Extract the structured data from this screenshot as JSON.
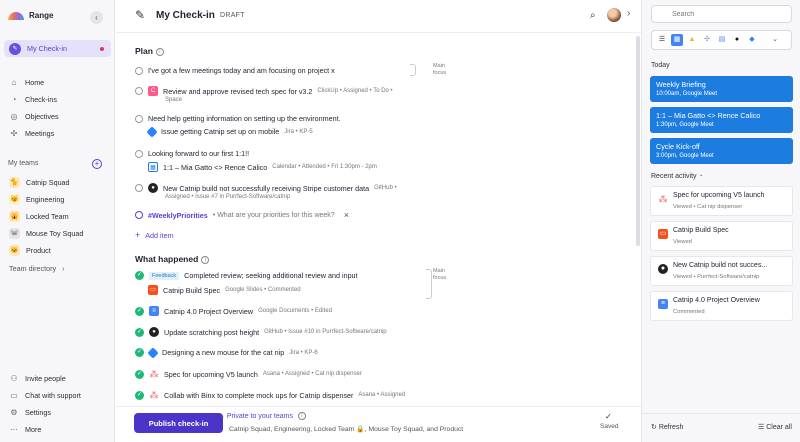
{
  "app": {
    "name": "Range"
  },
  "sidebar": {
    "primary": {
      "label": "My Check-in"
    },
    "nav": [
      {
        "label": "Home",
        "icon": "home-icon"
      },
      {
        "label": "Check-ins",
        "icon": "checkins-icon"
      },
      {
        "label": "Objectives",
        "icon": "target-icon"
      },
      {
        "label": "Meetings",
        "icon": "meetings-icon"
      }
    ],
    "teams_label": "My teams",
    "teams": [
      {
        "label": "Catnip Squad",
        "emoji": "🐈"
      },
      {
        "label": "Engineering",
        "emoji": "😼"
      },
      {
        "label": "Locked Team",
        "emoji": "🙀"
      },
      {
        "label": "Mouse Toy Squad",
        "emoji": "🐭"
      },
      {
        "label": "Product",
        "emoji": "🐱"
      }
    ],
    "team_directory": "Team directory",
    "bottom": [
      {
        "label": "Invite people",
        "icon": "invite-icon"
      },
      {
        "label": "Chat with support",
        "icon": "chat-icon"
      },
      {
        "label": "Settings",
        "icon": "settings-icon"
      },
      {
        "label": "More",
        "icon": "more-icon"
      }
    ]
  },
  "header": {
    "title": "My Check-in",
    "status": "DRAFT"
  },
  "plan": {
    "title": "Plan",
    "focus_label": "Main focus",
    "items": [
      {
        "text": "I've got a few meetings today and am focusing on project x"
      },
      {
        "text": "Review and approve revised tech spec for v3.2",
        "meta": "ClickUp • Assigned • To Do •",
        "meta2": "Space"
      },
      {
        "text": "Need help getting information on setting up the environment."
      },
      {
        "text": "Issue getting Catnip set up on mobile",
        "meta": "Jira • KP-5"
      },
      {
        "text": "Looking forward to our first 1:1!!"
      },
      {
        "text": "1:1 – Mia Gatto <> Rence Calico",
        "meta": "Calendar • Attended • Fri 1:30pm - 2pm"
      },
      {
        "text": "New Catnip build not successfully receiving Stripe customer data",
        "meta": "GitHub •",
        "meta2": "Assigned • Issue #7 in Purrfect-Software/catnip"
      }
    ],
    "hashtag": "#WeeklyPriorities",
    "hashtag_prompt": "• What are your priorities for this week?",
    "add_item": "Add item"
  },
  "happened": {
    "title": "What happened",
    "focus_label": "Main focus",
    "badge": "Feedback",
    "items": [
      {
        "text": "Completed review; seeking additional review and input"
      },
      {
        "text": "Catnip Build Spec",
        "meta": "Google Slides • Commented"
      },
      {
        "text": "Catnip 4.0 Project Overview",
        "meta": "Google Documents • Edited"
      },
      {
        "text": "Update scratching post height",
        "meta": "GitHub • Issue #10 in Purrfect-Software/catnip"
      },
      {
        "text": "Designing a new mouse for the cat nip",
        "meta": "Jira • KP-6"
      },
      {
        "text": "Spec for upcoming V5 launch",
        "meta": "Asana • Assigned • Cat nip dispenser"
      },
      {
        "text": "Collab with Binx to complete mock ups for Catnip dispenser",
        "meta": "Asana • Assigned"
      }
    ]
  },
  "footer": {
    "publish": "Publish check-in",
    "privacy": "Private to your teams",
    "teams_line": "Catnip Squad, Engineering, Locked Team 🔒, Mouse Toy Squad, and Product",
    "saved": "Saved"
  },
  "right": {
    "search_placeholder": "Search",
    "today": "Today",
    "events": [
      {
        "title": "Weekly Briefing",
        "sub": "10:00am, Google Meet"
      },
      {
        "title": "1:1 – Mia Gatto <> Rence Calico",
        "sub": "1:30pm, Google Meet"
      },
      {
        "title": "Cycle Kick-off",
        "sub": "3:00pm, Google Meet"
      }
    ],
    "recent_label": "Recent activity",
    "recent": [
      {
        "title": "Spec for upcoming V5 launch",
        "sub": "Viewed • Cat nip dispenser"
      },
      {
        "title": "Catnip Build Spec",
        "sub": "Viewed"
      },
      {
        "title": "New Catnip build not succes...",
        "sub": "Viewed • Purrfect-Software/catnip"
      },
      {
        "title": "Catnip 4.0 Project Overview",
        "sub": "Commented"
      }
    ],
    "refresh": "Refresh",
    "clear_all": "Clear all"
  },
  "colors": {
    "accent": "#5b3fd1",
    "calendar": "#1d7ce0",
    "done": "#1fb87a"
  }
}
